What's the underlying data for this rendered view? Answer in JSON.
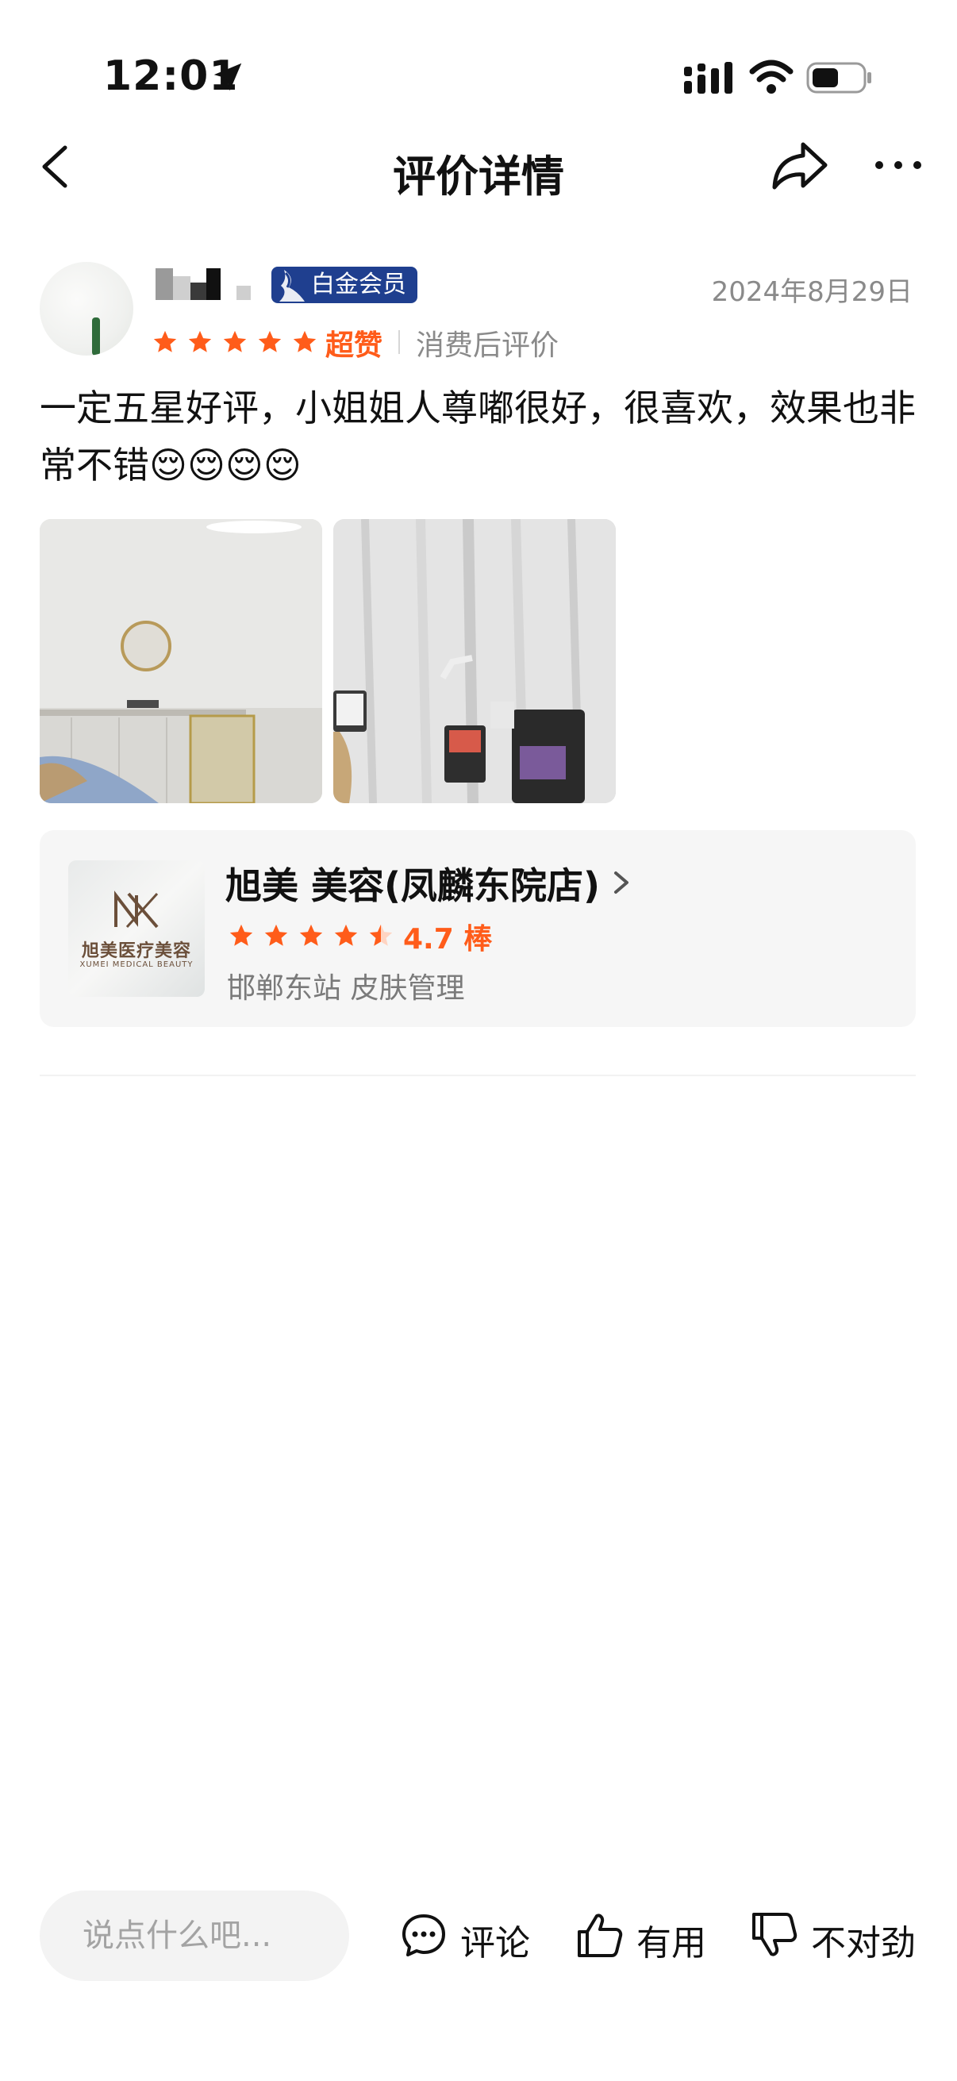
{
  "status_bar": {
    "time": "12:01"
  },
  "nav": {
    "title": "评价详情"
  },
  "review": {
    "member_badge": "白金会员",
    "date": "2024年8月29日",
    "stars": 5,
    "rating_word": "超赞",
    "rating_type": "消费后评价",
    "text": "一定五星好评，小姐姐人尊嘟很好，很喜欢，效果也非常不错😌😌😌😌",
    "photos": [
      "treatment-room-photo",
      "beauty-equipment-photo"
    ]
  },
  "shop": {
    "name": "旭美 美容(凤麟东院店)",
    "rating": 4.7,
    "score_label": "4.7 棒",
    "area_category": "邯郸东站 皮肤管理",
    "logo_cn": "旭美医疗美容",
    "logo_en": "XUMEI MEDICAL BEAUTY",
    "logo_mark": "XM"
  },
  "bottom_bar": {
    "input_placeholder": "说点什么吧...",
    "comment_label": "评论",
    "useful_label": "有用",
    "not_right_label": "不对劲"
  },
  "colors": {
    "accent": "#ff5c1a",
    "badge": "#1f3f8f",
    "muted": "#8a8a8a"
  },
  "icons": [
    "location-arrow-icon",
    "signal-icon",
    "wifi-icon",
    "battery-icon",
    "back-icon",
    "share-icon",
    "more-icon",
    "star-icon",
    "chevron-right-icon",
    "comment-icon",
    "thumbs-up-icon",
    "thumbs-down-icon"
  ]
}
